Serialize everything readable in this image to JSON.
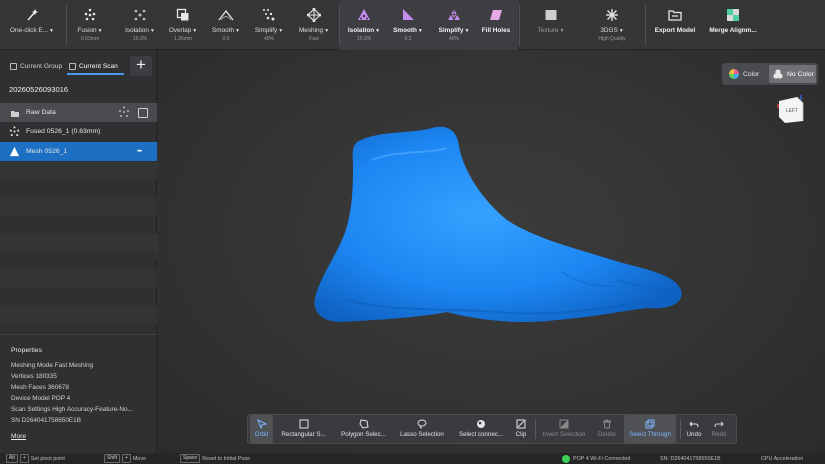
{
  "toolbar": {
    "one_click": {
      "label": "One-click E...",
      "icon": "magic-wand-icon"
    },
    "fusion": {
      "label": "Fusion",
      "sub": "0.63mm"
    },
    "isolation1": {
      "label": "Isolation",
      "sub": "15.0%"
    },
    "overlap": {
      "label": "Overlap",
      "sub": "1.26mm"
    },
    "smooth1": {
      "label": "Smooth",
      "sub": "0.0"
    },
    "simplify1": {
      "label": "Simplify",
      "sub": "40%"
    },
    "meshing": {
      "label": "Meshing",
      "sub": "Fast"
    },
    "isolation2": {
      "label": "Isolation",
      "sub": "15.0%"
    },
    "smooth2": {
      "label": "Smooth",
      "sub": "0.3"
    },
    "simplify2": {
      "label": "Simplify",
      "sub": "40%"
    },
    "fill_holes": {
      "label": "Fill Holes"
    },
    "texture": {
      "label": "Texture"
    },
    "threedgs": {
      "label": "3DGS",
      "sub": "High Quality"
    },
    "export_model": {
      "label": "Export Model"
    },
    "merge_alignment": {
      "label": "Merge Alignm..."
    }
  },
  "left_panel": {
    "tabs": {
      "current_group": "Current Group",
      "current_scan": "Current Scan"
    },
    "add_label": "+",
    "scan_id": "20260526093016",
    "items": [
      {
        "label": "Raw Data"
      },
      {
        "label": "Fused 0526_1 (0.63mm)"
      },
      {
        "label": "Mesh 0526_1",
        "more": "•••"
      }
    ],
    "properties": {
      "title": "Properties",
      "lines": [
        "Meshing Mode Fast Meshing",
        "Vertices 180335",
        "Mesh Faces 360678",
        "Device Model POP 4",
        "Scan Settings High Accuracy-Feature-No...",
        "SN D264041758650E1B"
      ],
      "more": "More"
    },
    "collapse_glyph": "‹"
  },
  "viewport": {
    "color_toggle": {
      "color": "Color",
      "no_color": "No Color",
      "selected": "No Color"
    },
    "model_color": "#1e88f5",
    "view_cube_label": "LEFT"
  },
  "selection_toolbar": {
    "orbit": "Orbit",
    "rectangular": "Rectangular S...",
    "polygon": "Polygon Selec...",
    "lasso": "Lasso Selection",
    "select_connected": "Select connec...",
    "clip": "Clip",
    "invert": "Invert Selection",
    "delete": "Delete",
    "select_through": "Select Through",
    "undo": "Undo",
    "redo": "Redo"
  },
  "status_bar": {
    "hint1_keys": [
      "Alt",
      "+"
    ],
    "hint1_text": "Set pivot point",
    "hint2_keys": [
      "Shift",
      "+"
    ],
    "hint2_text": "Move",
    "hint3_key": "Space",
    "hint3_text": "Reset to Initial Pose",
    "connection": "POP 4 Wi-Fi Connected",
    "sn": "SN: D264041758650E1B",
    "acceleration": "CPU Acceleration"
  }
}
